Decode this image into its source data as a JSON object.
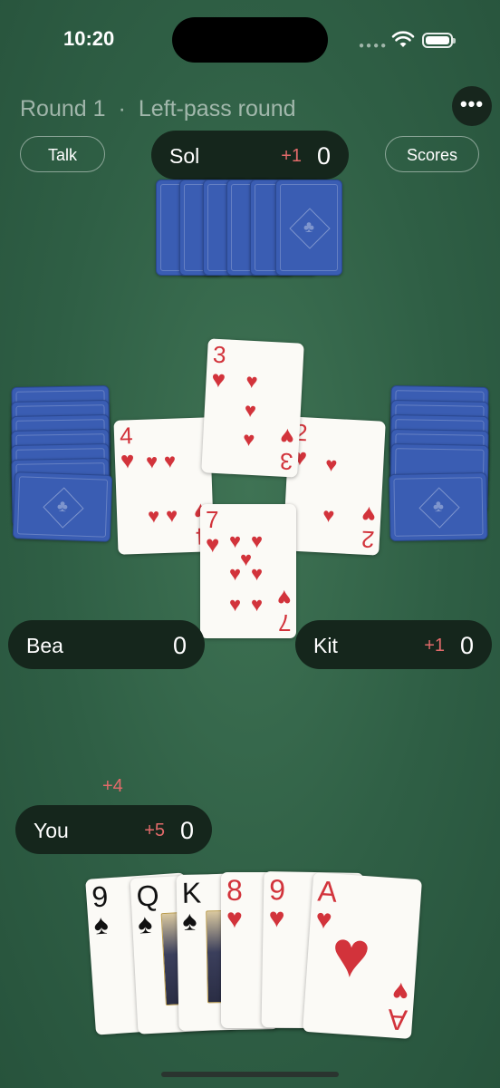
{
  "status_bar": {
    "time": "10:20"
  },
  "header": {
    "round": "Round 1",
    "separator": "·",
    "mode": "Left-pass round",
    "more_icon": "ellipsis-icon"
  },
  "buttons": {
    "talk": "Talk",
    "scores": "Scores"
  },
  "players": {
    "sol": {
      "name": "Sol",
      "delta": "+1",
      "score": "0"
    },
    "bea": {
      "name": "Bea",
      "score": "0"
    },
    "kit": {
      "name": "Kit",
      "delta": "+1",
      "score": "0"
    },
    "you": {
      "name": "You",
      "delta": "+5",
      "score": "0",
      "trick_delta": "+4"
    }
  },
  "card_back": {
    "color": "#3a5db3",
    "suit": "♣"
  },
  "trick": {
    "west": {
      "rank": "4",
      "suit": "♥",
      "color": "red"
    },
    "north": {
      "rank": "3",
      "suit": "♥",
      "color": "red"
    },
    "east": {
      "rank": "2",
      "suit": "♥",
      "color": "red"
    },
    "south": {
      "rank": "7",
      "suit": "♥",
      "color": "red"
    }
  },
  "hand": [
    {
      "rank": "9",
      "suit": "♠",
      "color": "black"
    },
    {
      "rank": "Q",
      "suit": "♠",
      "color": "black"
    },
    {
      "rank": "K",
      "suit": "♠",
      "color": "black"
    },
    {
      "rank": "8",
      "suit": "♥",
      "color": "red"
    },
    {
      "rank": "9",
      "suit": "♥",
      "color": "red"
    },
    {
      "rank": "A",
      "suit": "♥",
      "color": "red"
    }
  ],
  "colors": {
    "felt": "#2f5f45",
    "pill": "#15261c",
    "delta": "#e26a6a",
    "heart": "#d2333b"
  }
}
